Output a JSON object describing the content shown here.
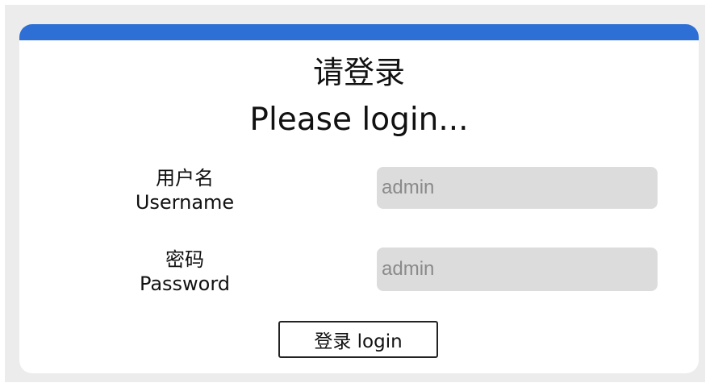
{
  "login": {
    "title_cn": "请登录",
    "title_en": "Please login...",
    "username": {
      "label_cn": "用户名",
      "label_en": "Username",
      "placeholder": "admin"
    },
    "password": {
      "label_cn": "密码",
      "label_en": "Password",
      "placeholder": "admin"
    },
    "button_label": "登录 login"
  },
  "colors": {
    "accent_bar": "#2d6fd4",
    "page_background": "#ececec",
    "card_background": "#ffffff",
    "input_background": "#dcdcdc"
  }
}
